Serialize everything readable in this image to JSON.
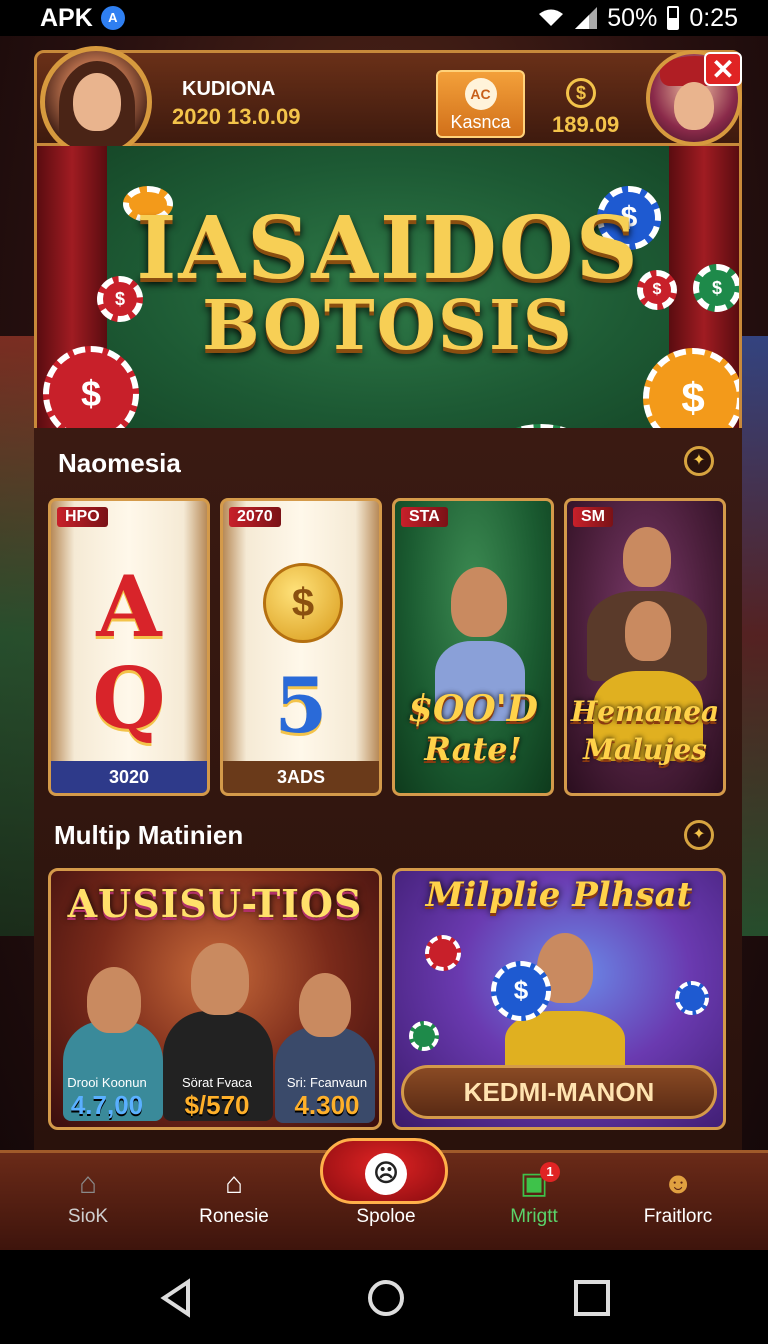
{
  "status_bar": {
    "app_label": "APK",
    "badge": "A",
    "battery": "50%",
    "time": "0:25"
  },
  "header": {
    "user_name": "KUDIONA",
    "user_date": "2020 13.0.09",
    "kasnca": {
      "logo": "AC",
      "label": "Kasnca"
    },
    "coins": "189.09",
    "close_label": "✕"
  },
  "banner": {
    "line1": "IASAIDOS",
    "line2": "BOTOSIS"
  },
  "section1": {
    "title": "Naomesia",
    "tiles": [
      {
        "tag": "HPO",
        "symbols": [
          "A",
          "Q"
        ],
        "footer": "3020"
      },
      {
        "tag": "2070",
        "symbols": [
          "5"
        ],
        "footer": "3ADS"
      },
      {
        "tag": "STA",
        "promo": [
          "$OO'D",
          "Rate!"
        ]
      },
      {
        "tag": "SM",
        "promo": [
          "Hemanea",
          "Malujes"
        ]
      }
    ]
  },
  "section2": {
    "title": "Multip Matinien",
    "card_left": {
      "title": "AUSISU-TIOS",
      "stats": [
        {
          "name": "Drooi Koonun",
          "value": "4.7,00"
        },
        {
          "name": "Sörat Fvaca",
          "value": "$/570"
        },
        {
          "name": "Sri: Fcanvaun",
          "value": "4.300"
        }
      ]
    },
    "card_right": {
      "title": "Milplie Plhsat",
      "button": "KEDMI-MANON"
    }
  },
  "bottom_nav": [
    {
      "label": "SioK",
      "icon": "home-star-icon"
    },
    {
      "label": "Ronesie",
      "icon": "house-icon"
    },
    {
      "label": "Spoloe",
      "icon": "face-icon"
    },
    {
      "label": "Mrigtt",
      "icon": "gift-icon",
      "badge": "1"
    },
    {
      "label": "Fraitlorc",
      "icon": "profile-add-icon"
    }
  ],
  "colors": {
    "accent_gold": "#f3c34a",
    "border_gold": "#d49a4a",
    "nav_active": "#5ad36a",
    "close_red": "#e02424"
  }
}
